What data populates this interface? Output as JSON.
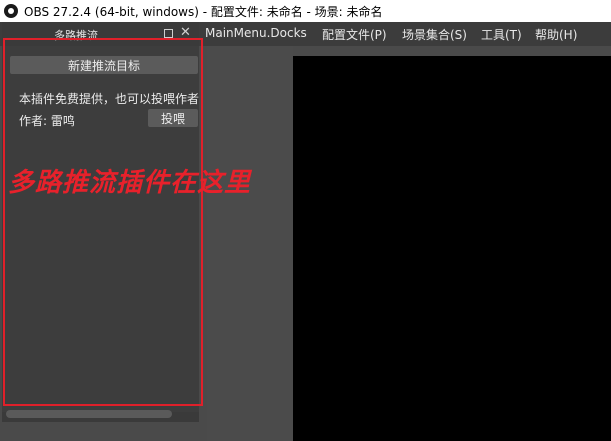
{
  "window": {
    "title": "OBS 27.2.4 (64-bit, windows) - 配置文件: 未命名 - 场景: 未命名"
  },
  "menubar": {
    "docks": "MainMenu.Docks",
    "profile": "配置文件(P)",
    "scene_collection": "场景集合(S)",
    "tools": "工具(T)",
    "help": "帮助(H)"
  },
  "dock": {
    "title": "多路推流",
    "new_target_button": "新建推流目标",
    "info_text": "本插件免费提供，也可以投喂作者",
    "author_label": "作者: 雷鸣",
    "donate_button": "投喂"
  },
  "annotation": {
    "text": "多路推流插件在这里",
    "color": "#e8212b"
  }
}
